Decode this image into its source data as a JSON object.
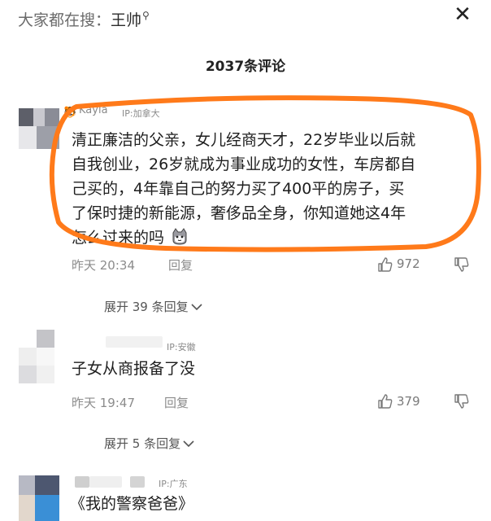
{
  "search_hint": {
    "prefix": "大家都在搜：",
    "query": "王帅"
  },
  "header": {
    "comment_count_title": "2037条评论"
  },
  "colors": {
    "highlight": "#ff7a1a",
    "muted_text": "#8c8c8c",
    "body_text": "#1e1e1e"
  },
  "comments": [
    {
      "username": "Kayla",
      "ip": "IP:加拿大",
      "text": [
        "清正廉洁的父亲，女儿经商天才，22岁毕业以后就",
        "自我创业，26岁就成为事业成功的女性，车房都自",
        "己买的，4年靠自己的努力买了400平的房子，买",
        "了保时捷的新能源，奢侈品全身，你知道她这4年",
        "怎么过来的吗"
      ],
      "emoji": "cat-emoji",
      "time": "昨天 20:34",
      "reply_label": "回复",
      "likes": "972",
      "expand": "展开 39 条回复"
    },
    {
      "username": "",
      "ip": "IP:安徽",
      "text": [
        "子女从商报备了没"
      ],
      "time": "昨天 19:47",
      "reply_label": "回复",
      "likes": "379",
      "expand": "展开 5 条回复"
    },
    {
      "username": "",
      "ip": "IP:广东",
      "text": [
        "《我的警察爸爸》"
      ]
    }
  ]
}
